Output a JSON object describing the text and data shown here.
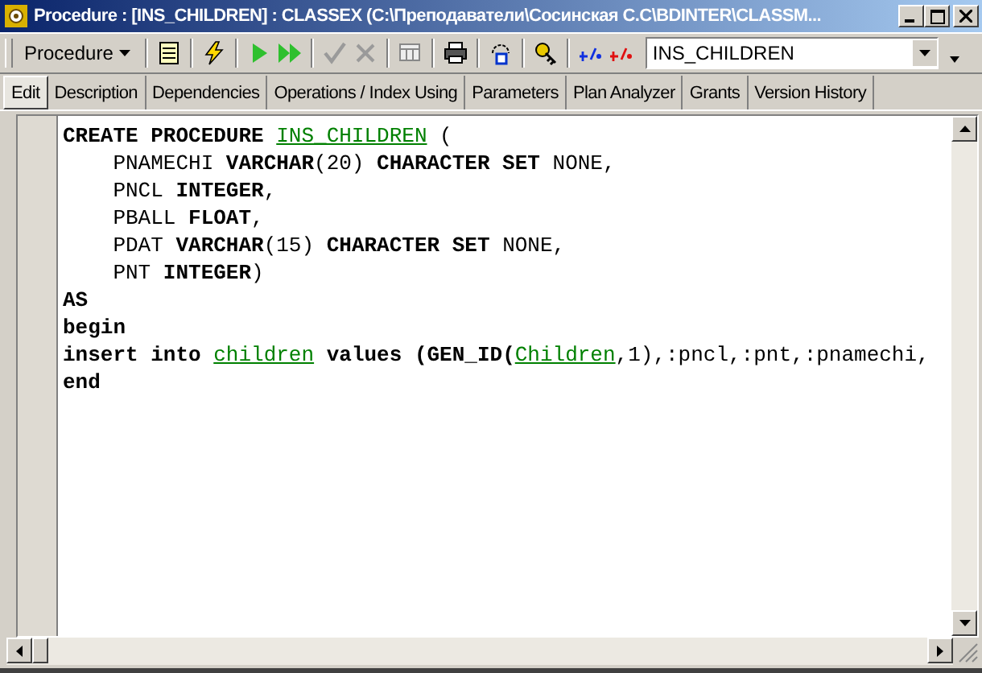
{
  "window": {
    "title": "Procedure : [INS_CHILDREN] : CLASSEX (C:\\Преподаватели\\Сосинская С.С\\BDINTER\\CLASSM..."
  },
  "toolbar": {
    "menu_button": "Procedure",
    "object_combo": {
      "value": "INS_CHILDREN"
    }
  },
  "tabs": [
    {
      "label": "Edit",
      "selected": true
    },
    {
      "label": "Description",
      "selected": false
    },
    {
      "label": "Dependencies",
      "selected": false
    },
    {
      "label": "Operations / Index Using",
      "selected": false
    },
    {
      "label": "Parameters",
      "selected": false
    },
    {
      "label": "Plan Analyzer",
      "selected": false
    },
    {
      "label": "Grants",
      "selected": false
    },
    {
      "label": "Version History",
      "selected": false
    }
  ],
  "code_lines": [
    [
      {
        "text": "CREATE PROCEDURE ",
        "kind": "keyword"
      },
      {
        "text": "INS_CHILDREN",
        "kind": "link"
      },
      {
        "text": " (",
        "kind": "plain"
      }
    ],
    [
      {
        "text": "    PNAMECHI ",
        "kind": "plain"
      },
      {
        "text": "VARCHAR",
        "kind": "keyword"
      },
      {
        "text": "(20) ",
        "kind": "plain"
      },
      {
        "text": "CHARACTER SET",
        "kind": "keyword"
      },
      {
        "text": " NONE,",
        "kind": "plain"
      }
    ],
    [
      {
        "text": "    PNCL ",
        "kind": "plain"
      },
      {
        "text": "INTEGER",
        "kind": "keyword"
      },
      {
        "text": ",",
        "kind": "plain"
      }
    ],
    [
      {
        "text": "    PBALL ",
        "kind": "plain"
      },
      {
        "text": "FLOAT",
        "kind": "keyword"
      },
      {
        "text": ",",
        "kind": "plain"
      }
    ],
    [
      {
        "text": "    PDAT ",
        "kind": "plain"
      },
      {
        "text": "VARCHAR",
        "kind": "keyword"
      },
      {
        "text": "(15) ",
        "kind": "plain"
      },
      {
        "text": "CHARACTER SET",
        "kind": "keyword"
      },
      {
        "text": " NONE,",
        "kind": "plain"
      }
    ],
    [
      {
        "text": "    PNT ",
        "kind": "plain"
      },
      {
        "text": "INTEGER",
        "kind": "keyword"
      },
      {
        "text": ")",
        "kind": "plain"
      }
    ],
    [
      {
        "text": "AS",
        "kind": "keyword"
      }
    ],
    [
      {
        "text": "begin",
        "kind": "keyword"
      }
    ],
    [
      {
        "text": "insert into ",
        "kind": "keyword"
      },
      {
        "text": "children",
        "kind": "link"
      },
      {
        "text": " values (GEN_ID(",
        "kind": "keyword"
      },
      {
        "text": "Children",
        "kind": "link"
      },
      {
        "text": ",1),:pncl,:pnt,:pnamechi,",
        "kind": "plain"
      }
    ],
    [
      {
        "text": "end",
        "kind": "keyword"
      }
    ]
  ]
}
